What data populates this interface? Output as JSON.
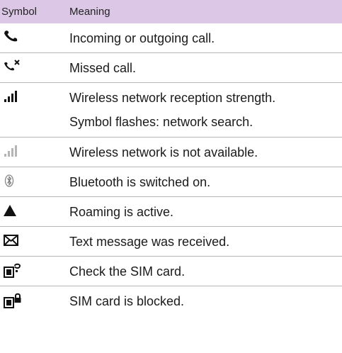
{
  "header": {
    "symbol_label": "Symbol",
    "meaning_label": "Meaning"
  },
  "rows": [
    {
      "icon": "phone-handset-icon",
      "lines": [
        "Incoming or outgoing call."
      ]
    },
    {
      "icon": "missed-call-icon",
      "lines": [
        "Missed call."
      ]
    },
    {
      "icon": "signal-strength-icon",
      "lines": [
        "Wireless network reception strength.",
        "Symbol flashes: network search."
      ]
    },
    {
      "icon": "no-network-icon",
      "lines": [
        "Wireless network is not available."
      ]
    },
    {
      "icon": "bluetooth-icon",
      "lines": [
        "Bluetooth is switched on."
      ]
    },
    {
      "icon": "roaming-triangle-icon",
      "lines": [
        "Roaming is active."
      ]
    },
    {
      "icon": "envelope-icon",
      "lines": [
        "Text message was received."
      ]
    },
    {
      "icon": "sim-check-icon",
      "lines": [
        "Check the SIM card."
      ]
    },
    {
      "icon": "sim-blocked-icon",
      "lines": [
        "SIM card is blocked."
      ]
    }
  ],
  "colors": {
    "header_bg": "#dcc8e6",
    "divider": "#b6b6b6",
    "text": "#1a1a1a"
  }
}
